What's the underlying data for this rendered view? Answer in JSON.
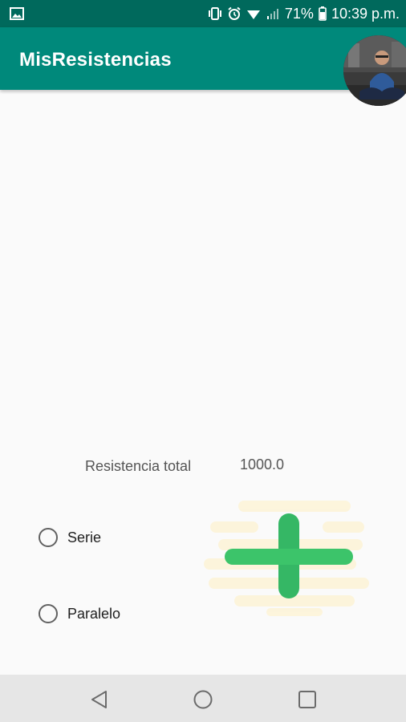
{
  "status_bar": {
    "battery_text": "71%",
    "time": "10:39 p.m.",
    "icons": [
      "image-notification-icon",
      "vibrate-icon",
      "alarm-icon",
      "wifi-icon",
      "signal-icon",
      "battery-icon"
    ]
  },
  "app_bar": {
    "title": "MisResistencias",
    "color": "#00897b",
    "status_color": "#00695c"
  },
  "main": {
    "total_label": "Resistencia total",
    "total_value": "1000.0",
    "options": [
      {
        "label": "Serie",
        "selected": false
      },
      {
        "label": "Paralelo",
        "selected": false
      }
    ],
    "add_icon": "plus-icon",
    "add_color": "#3cc46a"
  },
  "nav_bar": {
    "icons": [
      "back-icon",
      "home-icon",
      "recents-icon"
    ]
  }
}
